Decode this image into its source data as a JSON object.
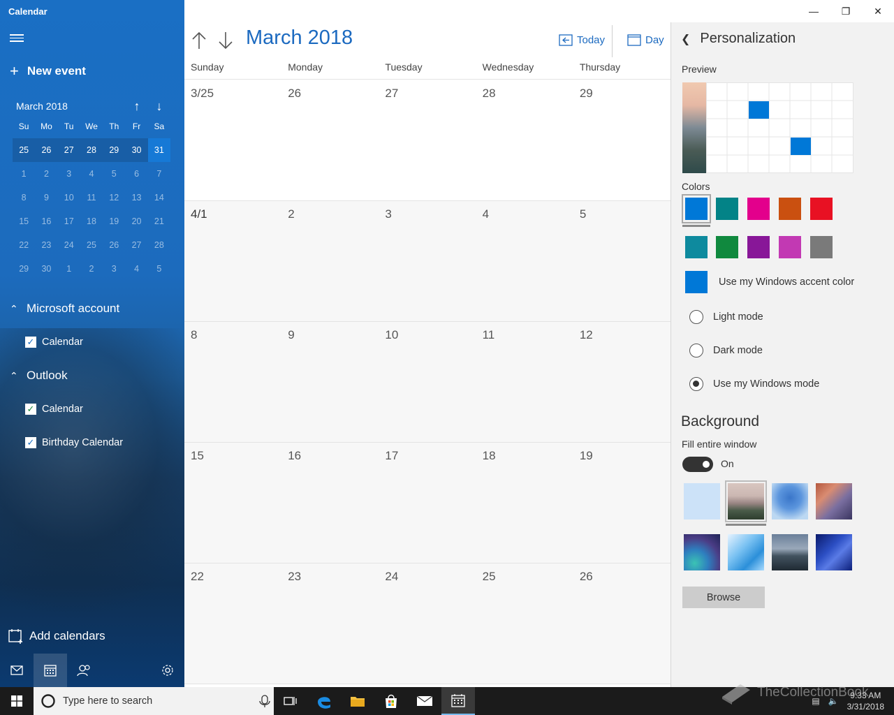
{
  "app": {
    "title": "Calendar"
  },
  "sidebar": {
    "new_event_label": "New event",
    "mini_calendar": {
      "title": "March 2018",
      "dow": [
        "Su",
        "Mo",
        "Tu",
        "We",
        "Th",
        "Fr",
        "Sa"
      ],
      "weeks": [
        [
          "25",
          "26",
          "27",
          "28",
          "29",
          "30",
          "31"
        ],
        [
          "1",
          "2",
          "3",
          "4",
          "5",
          "6",
          "7"
        ],
        [
          "8",
          "9",
          "10",
          "11",
          "12",
          "13",
          "14"
        ],
        [
          "15",
          "16",
          "17",
          "18",
          "19",
          "20",
          "21"
        ],
        [
          "22",
          "23",
          "24",
          "25",
          "26",
          "27",
          "28"
        ],
        [
          "29",
          "30",
          "1",
          "2",
          "3",
          "4",
          "5"
        ]
      ]
    },
    "accounts": [
      {
        "name": "Microsoft account",
        "calendars": [
          "Calendar"
        ]
      },
      {
        "name": "Outlook",
        "calendars": [
          "Calendar",
          "Birthday Calendar"
        ]
      }
    ],
    "add_calendars_label": "Add calendars"
  },
  "main": {
    "month_title": "March 2018",
    "today_label": "Today",
    "day_label": "Day",
    "days_of_week": [
      "Sunday",
      "Monday",
      "Tuesday",
      "Wednesday",
      "Thursday"
    ],
    "weeks": [
      [
        "3/25",
        "26",
        "27",
        "28",
        "29"
      ],
      [
        "4/1",
        "2",
        "3",
        "4",
        "5"
      ],
      [
        "8",
        "9",
        "10",
        "11",
        "12"
      ],
      [
        "15",
        "16",
        "17",
        "18",
        "19"
      ],
      [
        "22",
        "23",
        "24",
        "25",
        "26"
      ]
    ]
  },
  "personalization": {
    "title": "Personalization",
    "preview_label": "Preview",
    "colors_label": "Colors",
    "colors": [
      "#0078d7",
      "#038387",
      "#e3008c",
      "#ca5010",
      "#e81123",
      "#0e8a9e",
      "#10893e",
      "#881798",
      "#c239b3",
      "#7a7a7a"
    ],
    "accent_label": "Use my Windows accent color",
    "accent_color": "#0078d7",
    "modes": [
      "Light mode",
      "Dark mode",
      "Use my Windows mode"
    ],
    "background_title": "Background",
    "fill_label": "Fill entire window",
    "toggle_state": "On",
    "browse_label": "Browse"
  },
  "taskbar": {
    "search_placeholder": "Type here to search",
    "time": "9:33 AM",
    "date": "3/31/2018",
    "watermark": "TheCollectionBook"
  }
}
